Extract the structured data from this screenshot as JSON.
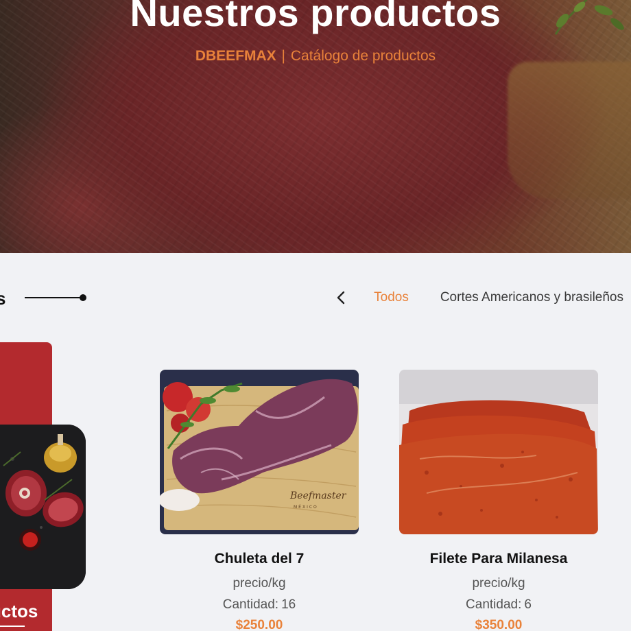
{
  "hero": {
    "title": "Nuestros productos",
    "brand": "DBEEFMAX",
    "separator": "|",
    "subtitle": "Catálogo de productos"
  },
  "section": {
    "title_fragment": "s"
  },
  "tabs": {
    "items": [
      "Todos",
      "Cortes Americanos y brasileños"
    ],
    "active": "Todos"
  },
  "promo": {
    "label_fragment": "uctos"
  },
  "products": [
    {
      "name": "Chuleta del 7",
      "unit": "precio/kg",
      "quantity_label": "Cantidad:",
      "quantity": "16",
      "price": "$250.00"
    },
    {
      "name": "Filete Para Milanesa",
      "unit": "precio/kg",
      "quantity_label": "Cantidad:",
      "quantity": "6",
      "price": "$350.00"
    }
  ],
  "colors": {
    "accent": "#e9823a",
    "promo_red": "#b32a2e",
    "page_bg": "#f1f2f5"
  },
  "icons": {
    "tab_prev": "chevron-left-icon",
    "section_line": "line-dot-decoration"
  }
}
